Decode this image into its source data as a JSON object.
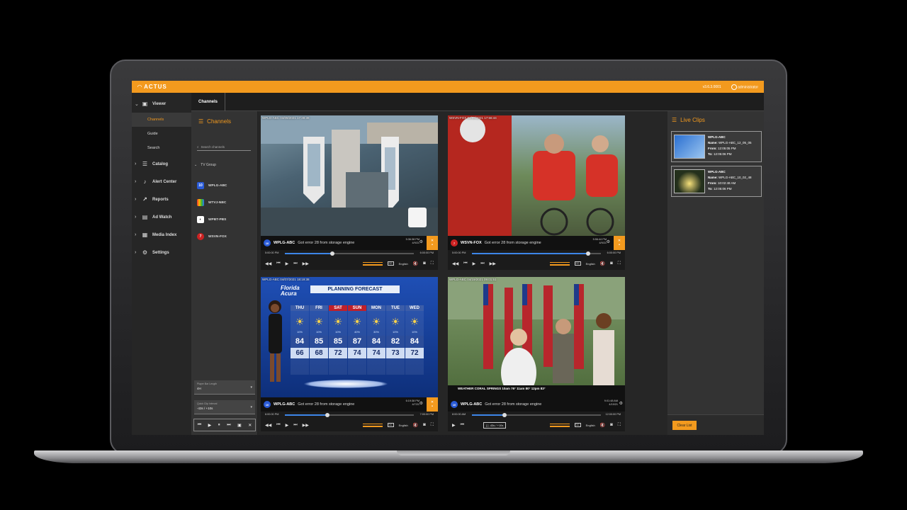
{
  "app": {
    "logo": "ACTUS",
    "version": "v3.6.3.0001",
    "user": "administrator"
  },
  "nav": {
    "viewer": "Viewer",
    "sub": [
      "Channels",
      "Guide",
      "Search"
    ],
    "items": [
      "Catalog",
      "Alert Center",
      "Reports",
      "Ad Watch",
      "Media Index",
      "Settings"
    ]
  },
  "tabs": [
    "Channels"
  ],
  "channels_panel": {
    "title": "Channels",
    "search_placeholder": "Search channels",
    "group": "TV Group",
    "list": [
      "WPLG-ABC",
      "WTVJ-NBC",
      "WPBT-PBS",
      "WSVN-FOX"
    ],
    "player_bar_label": "Player Bar Length",
    "player_bar_value": "4H",
    "quick_clip_label": "Quick Clip Interval",
    "quick_clip_value": "-43s / +10s"
  },
  "tiles": [
    {
      "stamp": "WPLG-ABC  04/09/2021 17:38:38",
      "channel": "WPLG-ABC",
      "error": "Got error 28 from storage engine",
      "time": "5:36:38 PM",
      "date": "4/9/21",
      "start": "5:00:00 PM",
      "end": "6:00:00 PM",
      "lang": "English",
      "progress": 0.37
    },
    {
      "stamp": "WSVN-FOX  04/09/2021 17:56:44",
      "channel": "WSVN-FOX",
      "error": "Got error 28 from storage engine",
      "time": "5:56:44 PM",
      "date": "4/9/21",
      "start": "5:00:00 PM",
      "end": "6:00:00 PM",
      "lang": "English",
      "progress": 0.9
    },
    {
      "stamp": "WPLG-ABC  04/07/2021 18:19:38",
      "channel": "WPLG-ABC",
      "error": "Got error 28 from storage engine",
      "time": "6:19:38 PM",
      "date": "4/7/21",
      "start": "6:00:00 PM",
      "end": "7:00:00 PM",
      "lang": "English",
      "progress": 0.33
    },
    {
      "stamp": "WPLG-ABC  04/19/2021 09:01:51",
      "channel": "WPLG-ABC",
      "error": "Got error 28 from storage engine",
      "time": "9:01:48 AM",
      "date": "4/19/21",
      "start": "8:00:00 AM",
      "end": "12:00:00 PM",
      "lang": "English",
      "progress": 0.25,
      "clip_range": "-43s / +10s"
    }
  ],
  "weather": {
    "brand": "Florida Acura",
    "title": "PLANNING FORECAST",
    "days": [
      "THU",
      "FRI",
      "SAT",
      "SUN",
      "MON",
      "TUE",
      "WED"
    ],
    "precip": [
      "10%",
      "10%",
      "10%",
      "40%",
      "30%",
      "10%",
      "10%"
    ],
    "highs": [
      "84",
      "85",
      "85",
      "87",
      "84",
      "82",
      "84"
    ],
    "lows": [
      "66",
      "68",
      "72",
      "74",
      "74",
      "73",
      "72"
    ]
  },
  "weather_ticker": "WEATHER  CORAL SPRINGS  10am 76°  11am 80°  12pm 83°",
  "live_clips": {
    "title": "Live Clips",
    "clips": [
      {
        "name_label": "Name:",
        "name": "WPLG-ABC_12_05_05",
        "from_label": "From:",
        "from": "12:05:05 PM",
        "to_label": "To:",
        "to": "12:05:06 PM",
        "channel": "WPLG-ABC"
      },
      {
        "name_label": "Name:",
        "name": "WPLG-ABC_10_02_48",
        "from_label": "From:",
        "from": "10:02:48 AM",
        "to_label": "To:",
        "to": "12:05:06 PM",
        "channel": "WPLG-ABC"
      }
    ],
    "clear": "Clear List"
  },
  "colors": {
    "accent": "#f39a1e",
    "progress": "#3d86e8"
  }
}
